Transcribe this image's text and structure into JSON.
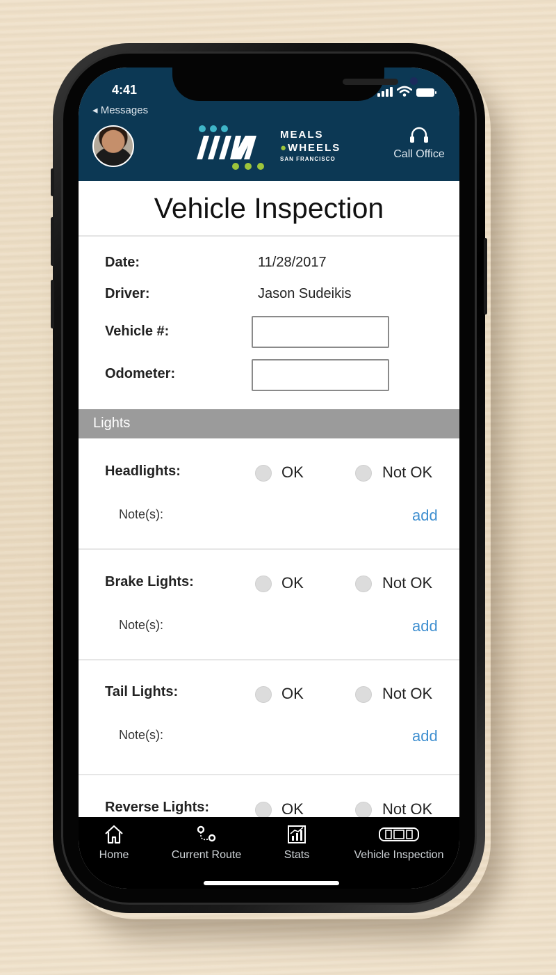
{
  "status_bar": {
    "time": "4:41",
    "back_label": "Messages"
  },
  "header": {
    "logo_line1": "MEALS",
    "logo_line2": "WHEELS",
    "logo_line3": "SAN FRANCISCO",
    "call_office_label": "Call Office"
  },
  "page": {
    "title": "Vehicle Inspection"
  },
  "info": {
    "date_label": "Date:",
    "date_value": "11/28/2017",
    "driver_label": "Driver:",
    "driver_value": "Jason Sudeikis",
    "vehicle_label": "Vehicle #:",
    "vehicle_value": "",
    "odometer_label": "Odometer:",
    "odometer_value": ""
  },
  "sections": {
    "lights": {
      "header": "Lights",
      "items": [
        {
          "label": "Headlights:",
          "ok_label": "OK",
          "notok_label": "Not OK",
          "notes_label": "Note(s):",
          "add_label": "add"
        },
        {
          "label": "Brake Lights:",
          "ok_label": "OK",
          "notok_label": "Not OK",
          "notes_label": "Note(s):",
          "add_label": "add"
        },
        {
          "label": "Tail Lights:",
          "ok_label": "OK",
          "notok_label": "Not OK",
          "notes_label": "Note(s):",
          "add_label": "add"
        },
        {
          "label": "Reverse Lights:",
          "ok_label": "OK",
          "notok_label": "Not OK"
        }
      ]
    }
  },
  "tabbar": {
    "home": "Home",
    "current_route": "Current Route",
    "stats": "Stats",
    "vehicle_inspection": "Vehicle Inspection"
  },
  "colors": {
    "header_bg": "#0c3854",
    "section_header_bg": "#9b9b9b",
    "link": "#3f8fd0",
    "logo_green": "#9dc53b",
    "logo_teal": "#3fb5c8"
  }
}
